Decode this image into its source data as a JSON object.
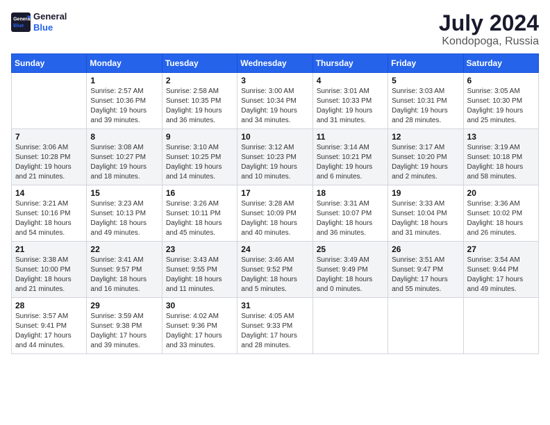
{
  "header": {
    "logo_general": "General",
    "logo_blue": "Blue",
    "month": "July 2024",
    "location": "Kondopoga, Russia"
  },
  "days_of_week": [
    "Sunday",
    "Monday",
    "Tuesday",
    "Wednesday",
    "Thursday",
    "Friday",
    "Saturday"
  ],
  "weeks": [
    [
      {
        "num": "",
        "detail": ""
      },
      {
        "num": "1",
        "detail": "Sunrise: 2:57 AM\nSunset: 10:36 PM\nDaylight: 19 hours\nand 39 minutes."
      },
      {
        "num": "2",
        "detail": "Sunrise: 2:58 AM\nSunset: 10:35 PM\nDaylight: 19 hours\nand 36 minutes."
      },
      {
        "num": "3",
        "detail": "Sunrise: 3:00 AM\nSunset: 10:34 PM\nDaylight: 19 hours\nand 34 minutes."
      },
      {
        "num": "4",
        "detail": "Sunrise: 3:01 AM\nSunset: 10:33 PM\nDaylight: 19 hours\nand 31 minutes."
      },
      {
        "num": "5",
        "detail": "Sunrise: 3:03 AM\nSunset: 10:31 PM\nDaylight: 19 hours\nand 28 minutes."
      },
      {
        "num": "6",
        "detail": "Sunrise: 3:05 AM\nSunset: 10:30 PM\nDaylight: 19 hours\nand 25 minutes."
      }
    ],
    [
      {
        "num": "7",
        "detail": "Sunrise: 3:06 AM\nSunset: 10:28 PM\nDaylight: 19 hours\nand 21 minutes."
      },
      {
        "num": "8",
        "detail": "Sunrise: 3:08 AM\nSunset: 10:27 PM\nDaylight: 19 hours\nand 18 minutes."
      },
      {
        "num": "9",
        "detail": "Sunrise: 3:10 AM\nSunset: 10:25 PM\nDaylight: 19 hours\nand 14 minutes."
      },
      {
        "num": "10",
        "detail": "Sunrise: 3:12 AM\nSunset: 10:23 PM\nDaylight: 19 hours\nand 10 minutes."
      },
      {
        "num": "11",
        "detail": "Sunrise: 3:14 AM\nSunset: 10:21 PM\nDaylight: 19 hours\nand 6 minutes."
      },
      {
        "num": "12",
        "detail": "Sunrise: 3:17 AM\nSunset: 10:20 PM\nDaylight: 19 hours\nand 2 minutes."
      },
      {
        "num": "13",
        "detail": "Sunrise: 3:19 AM\nSunset: 10:18 PM\nDaylight: 18 hours\nand 58 minutes."
      }
    ],
    [
      {
        "num": "14",
        "detail": "Sunrise: 3:21 AM\nSunset: 10:16 PM\nDaylight: 18 hours\nand 54 minutes."
      },
      {
        "num": "15",
        "detail": "Sunrise: 3:23 AM\nSunset: 10:13 PM\nDaylight: 18 hours\nand 49 minutes."
      },
      {
        "num": "16",
        "detail": "Sunrise: 3:26 AM\nSunset: 10:11 PM\nDaylight: 18 hours\nand 45 minutes."
      },
      {
        "num": "17",
        "detail": "Sunrise: 3:28 AM\nSunset: 10:09 PM\nDaylight: 18 hours\nand 40 minutes."
      },
      {
        "num": "18",
        "detail": "Sunrise: 3:31 AM\nSunset: 10:07 PM\nDaylight: 18 hours\nand 36 minutes."
      },
      {
        "num": "19",
        "detail": "Sunrise: 3:33 AM\nSunset: 10:04 PM\nDaylight: 18 hours\nand 31 minutes."
      },
      {
        "num": "20",
        "detail": "Sunrise: 3:36 AM\nSunset: 10:02 PM\nDaylight: 18 hours\nand 26 minutes."
      }
    ],
    [
      {
        "num": "21",
        "detail": "Sunrise: 3:38 AM\nSunset: 10:00 PM\nDaylight: 18 hours\nand 21 minutes."
      },
      {
        "num": "22",
        "detail": "Sunrise: 3:41 AM\nSunset: 9:57 PM\nDaylight: 18 hours\nand 16 minutes."
      },
      {
        "num": "23",
        "detail": "Sunrise: 3:43 AM\nSunset: 9:55 PM\nDaylight: 18 hours\nand 11 minutes."
      },
      {
        "num": "24",
        "detail": "Sunrise: 3:46 AM\nSunset: 9:52 PM\nDaylight: 18 hours\nand 5 minutes."
      },
      {
        "num": "25",
        "detail": "Sunrise: 3:49 AM\nSunset: 9:49 PM\nDaylight: 18 hours\nand 0 minutes."
      },
      {
        "num": "26",
        "detail": "Sunrise: 3:51 AM\nSunset: 9:47 PM\nDaylight: 17 hours\nand 55 minutes."
      },
      {
        "num": "27",
        "detail": "Sunrise: 3:54 AM\nSunset: 9:44 PM\nDaylight: 17 hours\nand 49 minutes."
      }
    ],
    [
      {
        "num": "28",
        "detail": "Sunrise: 3:57 AM\nSunset: 9:41 PM\nDaylight: 17 hours\nand 44 minutes."
      },
      {
        "num": "29",
        "detail": "Sunrise: 3:59 AM\nSunset: 9:38 PM\nDaylight: 17 hours\nand 39 minutes."
      },
      {
        "num": "30",
        "detail": "Sunrise: 4:02 AM\nSunset: 9:36 PM\nDaylight: 17 hours\nand 33 minutes."
      },
      {
        "num": "31",
        "detail": "Sunrise: 4:05 AM\nSunset: 9:33 PM\nDaylight: 17 hours\nand 28 minutes."
      },
      {
        "num": "",
        "detail": ""
      },
      {
        "num": "",
        "detail": ""
      },
      {
        "num": "",
        "detail": ""
      }
    ]
  ]
}
